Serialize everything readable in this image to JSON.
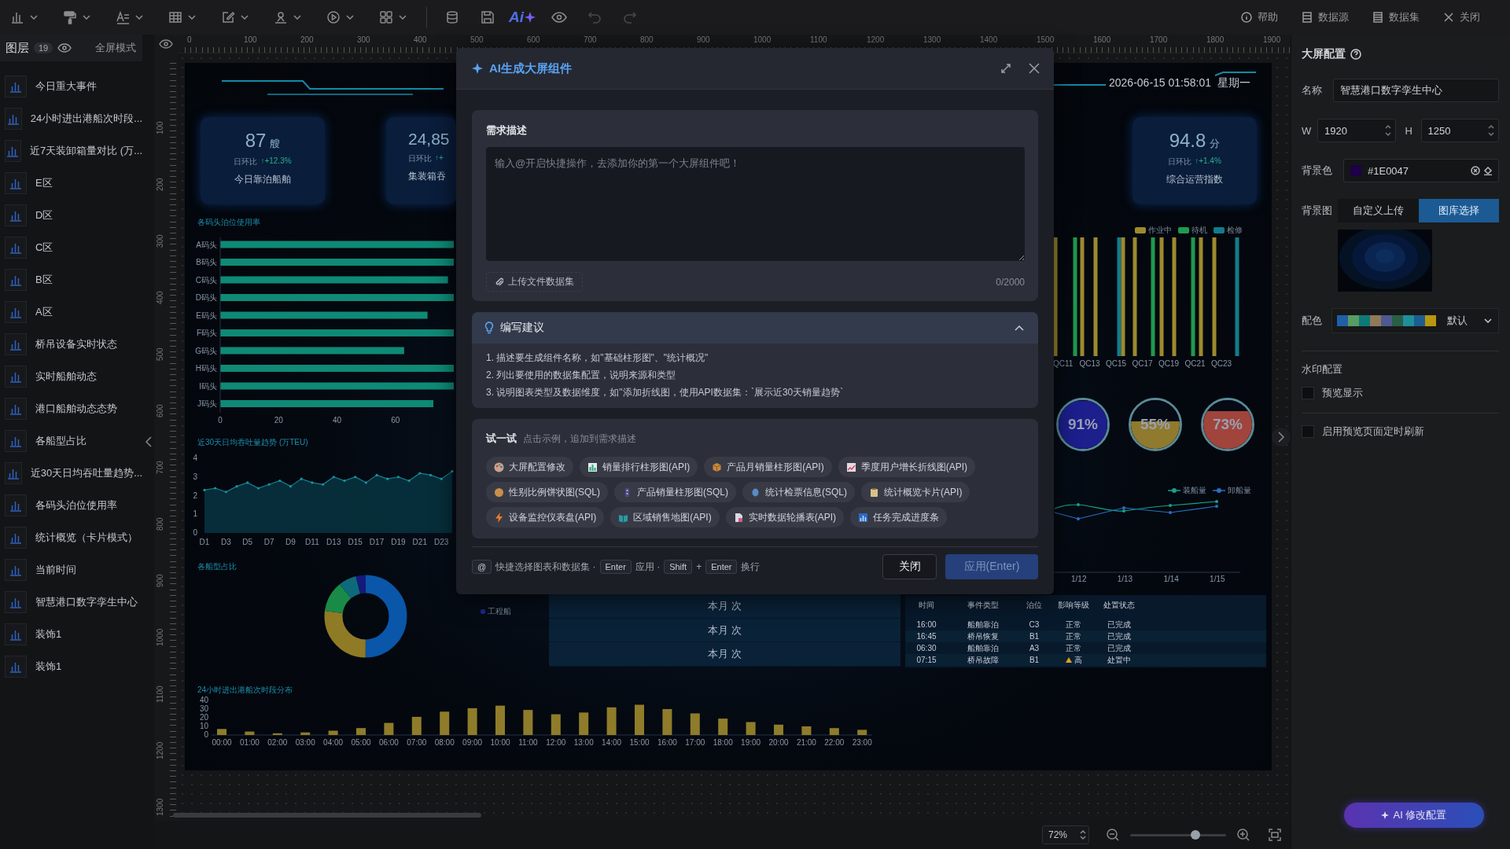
{
  "toolbar": {
    "ai_label": "Ai",
    "history": [
      {
        "kind": "undo",
        "disabled": true
      },
      {
        "kind": "redo",
        "disabled": true
      }
    ],
    "links": [
      {
        "kind": "help",
        "label": "帮助"
      },
      {
        "kind": "source",
        "label": "数据源"
      },
      {
        "kind": "dataset",
        "label": "数据集"
      },
      {
        "kind": "close",
        "label": "关闭"
      }
    ]
  },
  "layers": {
    "title": "图层",
    "count": "19",
    "mode_label": "全屏模式",
    "items": [
      {
        "label": "今日重大事件"
      },
      {
        "label": "24小时进出港船次时段..."
      },
      {
        "label": "近7天装卸箱量对比 (万..."
      },
      {
        "label": "E区"
      },
      {
        "label": "D区"
      },
      {
        "label": "C区"
      },
      {
        "label": "B区"
      },
      {
        "label": "A区"
      },
      {
        "label": "桥吊设备实时状态"
      },
      {
        "label": "实时船舶动态"
      },
      {
        "label": "港口船舶动态态势"
      },
      {
        "label": "各船型占比"
      },
      {
        "label": "近30天日均吞吐量趋势..."
      },
      {
        "label": "各码头泊位使用率"
      },
      {
        "label": "统计概览（卡片模式）"
      },
      {
        "label": "当前时间"
      },
      {
        "label": "智慧港口数字孪生中心"
      },
      {
        "label": "装饰1"
      },
      {
        "label": "装饰1"
      }
    ]
  },
  "ruler": {
    "x_labels": [
      "0",
      "100",
      "200",
      "300",
      "400",
      "500",
      "600",
      "700",
      "800",
      "900",
      "1000",
      "1100",
      "1200",
      "1300",
      "1400",
      "1500",
      "1600",
      "1700",
      "1800",
      "1900"
    ],
    "y_labels": [
      "100",
      "200",
      "300",
      "400",
      "500",
      "600",
      "700",
      "800",
      "900",
      "1000",
      "1100",
      "1200",
      "1300"
    ]
  },
  "screen": {
    "datetime": "2026-06-15 01:58:01  星期一",
    "stat_cards": [
      {
        "value": "87",
        "unit": "艘",
        "compare_label": "日环比",
        "change": "↑+12.3%",
        "title": "今日靠泊船舶"
      },
      {
        "value": "24,85",
        "compare_label": "日环比",
        "change": "↑+",
        "title": "集装箱吞"
      },
      {
        "value": "94.8",
        "unit": "分",
        "compare_label": "日环比",
        "change": "↑+1.4%",
        "title": "综合运营指数"
      }
    ],
    "berth_chart": {
      "chart_data": {
        "type": "bar",
        "orientation": "horizontal",
        "title": "各码头泊位使用率",
        "categories": [
          "A码头",
          "B码头",
          "C码头",
          "D码头",
          "E码头",
          "F码头",
          "G码头",
          "H码头",
          "I码头",
          "J码头"
        ],
        "values": [
          80,
          80,
          78,
          80,
          71,
          80,
          63,
          80,
          80,
          73
        ],
        "xlim": [
          0,
          80
        ],
        "xticks": [
          0,
          20,
          40,
          60
        ]
      }
    },
    "throughput_chart": {
      "chart_data": {
        "type": "area",
        "title": "近30天日均吞吐量趋势 (万TEU)",
        "categories": [
          "D1",
          null,
          "D3",
          null,
          "D5",
          null,
          "D7",
          null,
          "D9",
          null,
          "D11",
          null,
          "D13",
          null,
          "D15",
          null,
          "D17",
          null,
          "D19",
          null,
          "D21",
          null,
          "D23",
          null
        ],
        "values": [
          2.3,
          2.4,
          2.2,
          2.5,
          2.7,
          2.4,
          2.6,
          2.8,
          2.5,
          2.9,
          2.7,
          2.6,
          3.0,
          2.8,
          3.0,
          2.7,
          3.1,
          2.9,
          3.0,
          2.8,
          3.2,
          3.1,
          2.9,
          3.3
        ],
        "ylim": [
          0,
          4
        ],
        "yticks": [
          0,
          1,
          2,
          3,
          4
        ]
      }
    },
    "ship_type_chart": {
      "title": "各船型占比",
      "legend": [
        {
          "label": "工程船",
          "color": "#1a2a8a"
        }
      ]
    },
    "monthly_panel": {
      "rows": [
        "本月 次",
        "本月 次",
        "本月 次"
      ]
    },
    "event_table": {
      "columns": [
        "时间",
        "事件类型",
        "泊位",
        "影响等级",
        "处置状态"
      ],
      "rows": [
        {
          "cells": [
            "16:00",
            "船舶靠泊",
            "C3",
            "正常",
            "已完成"
          ],
          "alert": false
        },
        {
          "cells": [
            "16:45",
            "桥吊恢复",
            "B1",
            "正常",
            "已完成"
          ],
          "alert": false
        },
        {
          "cells": [
            "06:30",
            "船舶靠泊",
            "A3",
            "正常",
            "已完成"
          ],
          "alert": false
        },
        {
          "cells": [
            "07:15",
            "桥吊故障",
            "B1",
            "高",
            "处置中"
          ],
          "alert": true
        }
      ]
    },
    "hourly_chart": {
      "chart_data": {
        "type": "bar",
        "title": "24小时进出港船次时段分布",
        "categories": [
          "00:00",
          "01:00",
          "02:00",
          "03:00",
          "04:00",
          "05:00",
          "06:00",
          "07:00",
          "08:00",
          "09:00",
          "10:00",
          "11:00",
          "12:00",
          "13:00",
          "14:00",
          "15:00",
          "16:00",
          "17:00",
          "18:00",
          "19:00",
          "20:00",
          "21:00",
          "22:00",
          "23:00"
        ],
        "values": [
          7,
          4,
          2,
          3,
          5,
          8,
          14,
          21,
          27,
          31,
          34,
          29,
          24,
          26,
          32,
          35,
          30,
          25,
          19,
          15,
          12,
          10,
          8,
          6
        ],
        "ylim": [
          0,
          40
        ],
        "yticks": [
          0,
          10,
          20,
          30,
          40
        ]
      }
    },
    "crane_chart": {
      "legend": [
        {
          "label": "作业中",
          "color": "#9c8a2e"
        },
        {
          "label": "待机",
          "color": "#1e9a52"
        },
        {
          "label": "检修",
          "color": "#127c8c"
        }
      ],
      "categories": [
        "QC11",
        "QC13",
        "QC15",
        "QC17",
        "QC19",
        "QC21",
        "QC23"
      ]
    },
    "gauges": [
      {
        "reading": "91%",
        "level": 0.91,
        "color": "#1c1f8c"
      },
      {
        "reading": "55%",
        "level": 0.55,
        "color": "#8f7a2e"
      },
      {
        "reading": "73%",
        "level": 0.73,
        "color": "#a0443c"
      }
    ],
    "vessel_line_chart": {
      "legend": [
        {
          "label": "装船量",
          "color": "#19a08a"
        },
        {
          "label": "卸船量",
          "color": "#2b6fc4"
        }
      ],
      "x_labels": [
        "1/12",
        "1/13",
        "1/14",
        "1/15"
      ]
    }
  },
  "zoom": {
    "value": "72%",
    "level": 0.68
  },
  "config": {
    "title": "大屏配置",
    "name_label": "名称",
    "name_value": "智慧港口数字孪生中心",
    "width_label": "W",
    "width_value": "1920",
    "height_label": "H",
    "height_value": "1250",
    "bg_color_label": "背景色",
    "bg_color_value": "#1E0047",
    "bg_image_label": "背景图",
    "bg_image_tabs": [
      {
        "label": "自定义上传",
        "selected": false
      },
      {
        "label": "图库选择",
        "selected": true
      }
    ],
    "palette_label": "配色",
    "palette": [
      {
        "color": "#1f5fa6"
      },
      {
        "color": "#5a9a63"
      },
      {
        "color": "#0e7a78"
      },
      {
        "color": "#8f7a5a"
      },
      {
        "color": "#4e5a8f"
      },
      {
        "color": "#285f45"
      },
      {
        "color": "#1f8f9a"
      },
      {
        "color": "#1d5d8f"
      },
      {
        "color": "#b8960f"
      }
    ],
    "palette_name": "默认",
    "watermark_title": "水印配置",
    "options": [
      {
        "label": "预览显示",
        "checked": false
      },
      {
        "label": "启用预览页面定时刷新",
        "checked": false
      }
    ],
    "ai_button": "AI 修改配置"
  },
  "dialog": {
    "title": "AI生成大屏组件",
    "requirement": {
      "title": "需求描述",
      "placeholder": "输入@开启快捷操作，去添加你的第一个大屏组件吧！",
      "upload_label": "上传文件数据集",
      "counter": "0/2000"
    },
    "tips": {
      "title": "编写建议",
      "expanded": true,
      "items": [
        "1. 描述要生成组件名称，如\"基础柱形图\"、\"统计概况\"",
        "2. 列出要使用的数据集配置，说明来源和类型",
        "3. 说明图表类型及数据维度，如\"添加折线图，使用API数据集：`展示近30天销量趋势`"
      ]
    },
    "try": {
      "title": "试一试",
      "hint": "点击示例，追加到需求描述",
      "examples": [
        {
          "label": "大屏配置修改"
        },
        {
          "label": "销量排行柱形图(API)"
        },
        {
          "label": "产品月销量柱形图(API)"
        },
        {
          "label": "季度用户增长折线图(API)"
        },
        {
          "label": "性别比例饼状图(SQL)"
        },
        {
          "label": "产品销量柱形图(SQL)"
        },
        {
          "label": "统计检票信息(SQL)"
        },
        {
          "label": "统计概览卡片(API)"
        },
        {
          "label": "设备监控仪表盘(API)"
        },
        {
          "label": "区域销售地图(API)"
        },
        {
          "label": "实时数据轮播表(API)"
        },
        {
          "label": "任务完成进度条"
        }
      ]
    },
    "shortcuts": [
      {
        "kind": "key",
        "text": "@"
      },
      {
        "kind": "text",
        "text": "快捷选择图表和数据集 ·"
      },
      {
        "kind": "key",
        "text": "Enter"
      },
      {
        "kind": "text",
        "text": "应用 ·"
      },
      {
        "kind": "key",
        "text": "Shift"
      },
      {
        "kind": "text",
        "text": "+"
      },
      {
        "kind": "key",
        "text": "Enter"
      },
      {
        "kind": "text",
        "text": "换行"
      }
    ],
    "buttons": [
      {
        "kind": "secondary",
        "label": "关闭"
      },
      {
        "kind": "primary",
        "label": "应用(Enter)",
        "disabled": true
      }
    ]
  }
}
